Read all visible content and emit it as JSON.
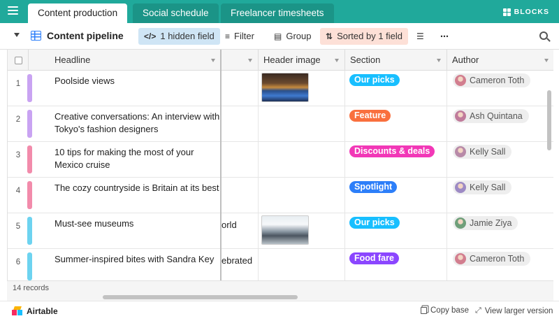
{
  "tabs": [
    {
      "label": "Content production",
      "active": true
    },
    {
      "label": "Social schedule",
      "active": false
    },
    {
      "label": "Freelancer timesheets",
      "active": false
    }
  ],
  "blocks_label": "BLOCKS",
  "view": {
    "name": "Content pipeline",
    "hidden_fields": "1 hidden field",
    "filter": "Filter",
    "group": "Group",
    "sorted": "Sorted by 1 field"
  },
  "columns": {
    "headline": "Headline",
    "header_image": "Header image",
    "section": "Section",
    "author": "Author"
  },
  "rows": [
    {
      "num": "1",
      "headline": "Poolside views",
      "frag": "",
      "image": "pool",
      "section": "Our picks",
      "section_color": "#18bfff",
      "author": "Cameron Toth",
      "bar": "#c9a3f2"
    },
    {
      "num": "2",
      "headline": "Creative conversations: An interview with Tokyo's fashion designers",
      "frag": "",
      "image": "",
      "section": "Feature",
      "section_color": "#f9703e",
      "author": "Ash Quintana",
      "bar": "#c9a3f2"
    },
    {
      "num": "3",
      "headline": "10 tips for making the most of your Mexico cruise",
      "frag": "",
      "image": "",
      "section": "Discounts & deals",
      "section_color": "#f238b7",
      "author": "Kelly Sall",
      "bar": "#f28bab"
    },
    {
      "num": "4",
      "headline": "The cozy countryside is Britain at its best",
      "frag": "",
      "image": "",
      "section": "Spotlight",
      "section_color": "#2d7ff9",
      "author": "Kelly Sall",
      "bar": "#f28bab"
    },
    {
      "num": "5",
      "headline": "Must-see museums",
      "frag": "orld",
      "image": "museum",
      "section": "Our picks",
      "section_color": "#18bfff",
      "author": "Jamie Ziya",
      "bar": "#6dd3f0"
    },
    {
      "num": "6",
      "headline": "Summer-inspired bites with Sandra Key",
      "frag": "ebrated",
      "image": "",
      "section": "Food fare",
      "section_color": "#8b46ff",
      "author": "Cameron Toth",
      "bar": "#6dd3f0"
    }
  ],
  "records": "14 records",
  "footer": {
    "brand": "Airtable",
    "copy_base": "Copy base",
    "view_larger": "View larger version"
  },
  "colors": {
    "topbar": "#20a99b",
    "hidden_field_bg": "#cfe5f5",
    "sorted_bg": "#fde0d7"
  }
}
